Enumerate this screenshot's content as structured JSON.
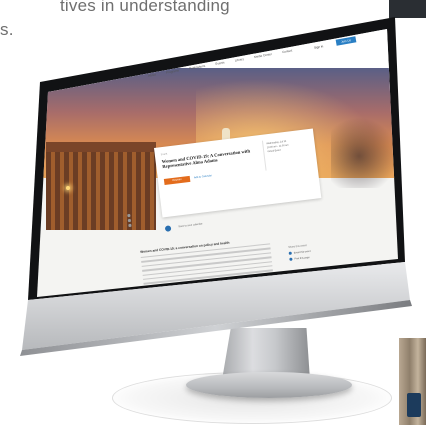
{
  "background_text": {
    "line1": "tives in understanding",
    "line2": "s."
  },
  "site": {
    "logo": "KFF",
    "nav_items": [
      "About",
      "Programs",
      "Publications",
      "Events",
      "Library",
      "Media Center",
      "Contact"
    ],
    "sign_in": "Sign In",
    "join_button": "Join Us"
  },
  "event": {
    "breadcrumb": "Event",
    "title": "Women and COVID-19: A Conversation with Representative Alma Adams",
    "register_button": "Register",
    "save_link": "Add to Calendar",
    "meta_lines": [
      "Wednesday, Jul 22",
      "10:00 am - 11:00 am",
      "Virtual Event"
    ],
    "calendar_text": "Save to your calendar"
  },
  "body": {
    "heading": "Women and COVID-19: a conversation on policy and health",
    "line_count": 9
  },
  "sidebar": {
    "heading": "Share this event",
    "items": [
      "Email this event",
      "Print this page"
    ]
  },
  "colors": {
    "accent_orange": "#e36c1c",
    "accent_blue": "#2a7fc4",
    "logo_orange": "#e8862a"
  }
}
